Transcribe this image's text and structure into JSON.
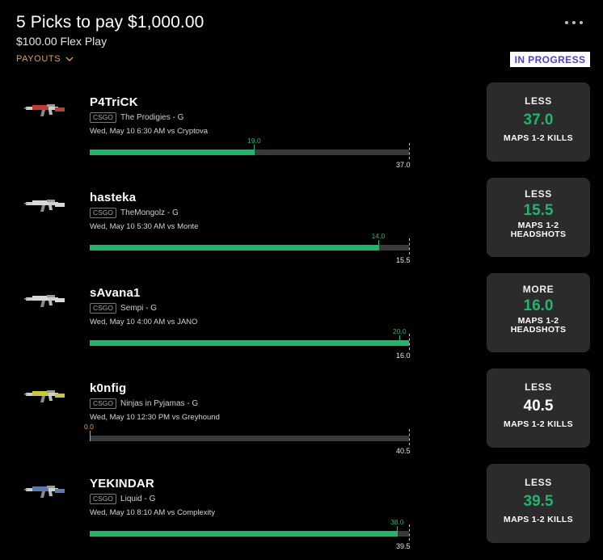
{
  "header": {
    "title": "5 Picks to pay $1,000.00",
    "subtitle": "$100.00 Flex Play",
    "payouts_label": "PAYOUTS",
    "status": "IN PROGRESS"
  },
  "picks": [
    {
      "player": "P4TriCK",
      "game": "CSGO",
      "team": "The Prodigies - G",
      "time": "Wed, May 10 6:30 AM  vs Cryptova",
      "current": "19.0",
      "line": "37.0",
      "progress": 0.514,
      "direction": "LESS",
      "value": "37.0",
      "stat": "MAPS 1-2 KILLS",
      "value_color": "green",
      "gun_color": "#c23a3a"
    },
    {
      "player": "hasteka",
      "game": "CSGO",
      "team": "TheMongolz - G",
      "time": "Wed, May 10 5:30 AM  vs Monte",
      "current": "14.0",
      "line": "15.5",
      "progress": 0.903,
      "direction": "LESS",
      "value": "15.5",
      "stat": "MAPS 1-2 HEADSHOTS",
      "value_color": "green",
      "gun_color": "#d9d9d9"
    },
    {
      "player": "sAvana1",
      "game": "CSGO",
      "team": "Sempi - G",
      "time": "Wed, May 10 4:00 AM  vs JANO",
      "current": "20.0",
      "line": "16.0",
      "progress": 1.0,
      "direction": "MORE",
      "value": "16.0",
      "stat": "MAPS 1-2 HEADSHOTS",
      "value_color": "green",
      "gun_color": "#d9d9d9"
    },
    {
      "player": "k0nfig",
      "game": "CSGO",
      "team": "Ninjas in Pyjamas - G",
      "time": "Wed, May 10 12:30 PM  vs Greyhound",
      "current": "0.0",
      "line": "40.5",
      "progress": 0.0,
      "direction": "LESS",
      "value": "40.5",
      "stat": "MAPS 1-2 KILLS",
      "value_color": "white",
      "gun_color": "#c9c930"
    },
    {
      "player": "YEKINDAR",
      "game": "CSGO",
      "team": "Liquid - G",
      "time": "Wed, May 10 8:10 AM  vs Complexity",
      "current": "38.0",
      "line": "39.5",
      "progress": 0.962,
      "direction": "LESS",
      "value": "39.5",
      "stat": "MAPS 1-2 KILLS",
      "value_color": "green",
      "gun_color": "#5a7ab0"
    }
  ],
  "colors": {
    "accent_green": "#1ab86a",
    "payouts_orange": "#e0a33a",
    "status_purple": "#4b3fe0",
    "card_bg": "#2b2b2b"
  },
  "icons": {
    "menu": "more-horizontal-icon",
    "payouts": "chevron-down-icon",
    "gun": "rifle-icon"
  }
}
